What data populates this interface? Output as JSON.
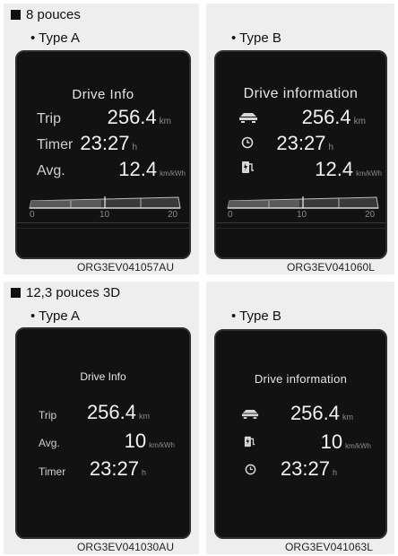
{
  "sections": [
    {
      "heading": "8 pouces",
      "type_a": {
        "type_label": "• Type A",
        "title": "Drive Info",
        "rows": [
          {
            "label": "Trip",
            "value": "256.4",
            "unit": "km"
          },
          {
            "label": "Timer",
            "value": "23:27",
            "unit": "h"
          },
          {
            "label": "Avg.",
            "value": "12.4",
            "unit": "km/kWh"
          }
        ],
        "scale": {
          "min": "0",
          "mid": "10",
          "max": "20"
        },
        "caption": "ORG3EV041057AU"
      },
      "type_b": {
        "type_label": "• Type B",
        "title": "Drive information",
        "rows": [
          {
            "icon": "car-trip-icon",
            "value": "256.4",
            "unit": "km"
          },
          {
            "icon": "clock-icon",
            "value": "23:27",
            "unit": "h"
          },
          {
            "icon": "charging-station-icon",
            "value": "12.4",
            "unit": "km/kWh"
          }
        ],
        "scale": {
          "min": "0",
          "mid": "10",
          "max": "20"
        },
        "caption": "ORG3EV041060L"
      }
    },
    {
      "heading": "12,3 pouces 3D",
      "type_a": {
        "type_label": "• Type A",
        "title": "Drive Info",
        "rows": [
          {
            "label": "Trip",
            "value": "256.4",
            "unit": "km"
          },
          {
            "label": "Avg.",
            "value": "10",
            "unit": "km/kWh"
          },
          {
            "label": "Timer",
            "value": "23:27",
            "unit": "h"
          }
        ],
        "caption": "ORG3EV041030AU"
      },
      "type_b": {
        "type_label": "• Type B",
        "title": "Drive information",
        "rows": [
          {
            "icon": "car-trip-icon",
            "value": "256.4",
            "unit": "km"
          },
          {
            "icon": "charging-station-icon",
            "value": "10",
            "unit": "km/kWh"
          },
          {
            "icon": "clock-icon",
            "value": "23:27",
            "unit": "h"
          }
        ],
        "caption": "ORG3EV041063L"
      }
    }
  ],
  "colors": {
    "panel": "#eeeeee",
    "screen": "#121212",
    "unit": "#8c8c8c",
    "text": "#f2f2f2"
  }
}
